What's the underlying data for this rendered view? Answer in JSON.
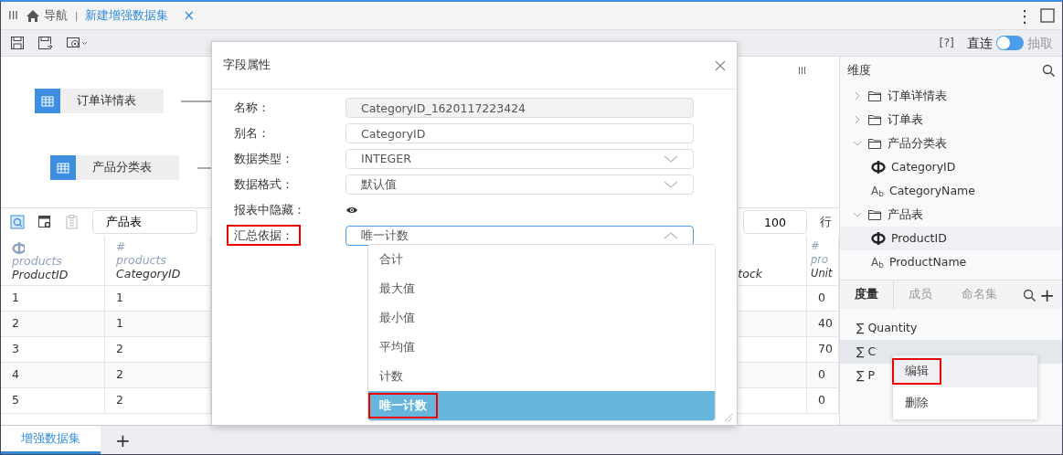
{
  "top_bar": {
    "menu_glyph": "III",
    "nav_label": "导航",
    "separator_glyph": "|",
    "tabs": [
      {
        "label": "新建增强数据集",
        "selected": true
      }
    ],
    "close_glyph": "×",
    "more_glyph": "⋮"
  },
  "toolbar": {
    "help": "[?]",
    "mode_options": [
      {
        "label": "直连",
        "selected": true
      },
      {
        "label": "抽取",
        "selected": false
      }
    ]
  },
  "diagram": {
    "handle_glyph": "III",
    "nodes": [
      {
        "label": "订单详情表"
      },
      {
        "label": "产品分类表"
      }
    ]
  },
  "table_toolbar": {
    "table_name": "产品表",
    "row_limit": "100",
    "row_unit": "行"
  },
  "table": {
    "columns": [
      {
        "kind": "key",
        "source": "products",
        "name": "ProductID"
      },
      {
        "kind": "number",
        "type_glyph": "#",
        "source": "products",
        "name": "CategoryID"
      },
      {
        "kind": "plain",
        "name": "tock"
      },
      {
        "kind": "number",
        "type_glyph": "#",
        "source": "pro",
        "name": "Unit"
      }
    ],
    "rows": [
      {
        "column_1": "1",
        "column_2": "1",
        "column_4": "0"
      },
      {
        "column_1": "2",
        "column_2": "1",
        "column_4": "40"
      },
      {
        "column_1": "3",
        "column_2": "2",
        "column_4": "70"
      },
      {
        "column_1": "4",
        "column_2": "2",
        "column_4": "0"
      },
      {
        "column_1": "5",
        "column_2": "2",
        "column_4": "0"
      }
    ]
  },
  "dimensions": {
    "title": "维度",
    "items": [
      {
        "label": "订单详情表",
        "expanded": false
      },
      {
        "label": "订单表",
        "expanded": false
      },
      {
        "label": "产品分类表",
        "expanded": true,
        "children": [
          {
            "kind": "key",
            "label": "CategoryID",
            "selected": false
          },
          {
            "kind": "text",
            "glyph": "A$_{b}$",
            "label": "CategoryName",
            "selected": false
          }
        ]
      },
      {
        "label": "产品表",
        "expanded": true,
        "children": [
          {
            "kind": "key",
            "label": "ProductID",
            "selected": true
          },
          {
            "kind": "text",
            "glyph": "A$_{b}$",
            "label": "ProductName",
            "selected": false
          }
        ]
      }
    ]
  },
  "measures": {
    "tabs": [
      {
        "label": "度量",
        "selected": true
      },
      {
        "label": "成员",
        "selected": false
      },
      {
        "label": "命名集",
        "selected": false
      }
    ],
    "add_glyph": "+",
    "items": [
      {
        "glyph": "∑",
        "label": "Quantity",
        "hovered": false
      },
      {
        "glyph": "∑",
        "label": "C",
        "hovered": true
      },
      {
        "glyph": "∑",
        "label": "P",
        "hovered": false
      }
    ]
  },
  "field_dialog": {
    "title": "字段属性",
    "fields": [
      {
        "kind": "readonly",
        "label": "名称：",
        "value": "CategoryID_1620117223424",
        "annotated": false
      },
      {
        "kind": "text",
        "label": "别名：",
        "value": "CategoryID",
        "annotated": false
      },
      {
        "kind": "select",
        "label": "数据类型：",
        "value": "INTEGER",
        "open": false,
        "annotated": false
      },
      {
        "kind": "select",
        "label": "数据格式：",
        "value": "默认值",
        "open": false,
        "annotated": false
      },
      {
        "kind": "visibility",
        "label": "报表中隐藏：",
        "annotated": false
      },
      {
        "kind": "select",
        "label": "汇总依据：",
        "value": "唯一计数",
        "open": true,
        "annotated": true
      }
    ],
    "options": [
      {
        "label": "合计",
        "selected": false,
        "annotated": false
      },
      {
        "label": "最大值",
        "selected": false,
        "annotated": false
      },
      {
        "label": "最小值",
        "selected": false,
        "annotated": false
      },
      {
        "label": "平均值",
        "selected": false,
        "annotated": false
      },
      {
        "label": "计数",
        "selected": false,
        "annotated": false
      },
      {
        "label": "唯一计数",
        "selected": true,
        "annotated": true
      }
    ]
  },
  "context_menu": {
    "items": [
      {
        "label": "编辑",
        "hovered": true,
        "annotated": true
      },
      {
        "label": "删除",
        "hovered": false,
        "annotated": false
      }
    ]
  },
  "bottom_tabs": {
    "tabs": [
      {
        "label": "增强数据集",
        "selected": true
      }
    ],
    "add_glyph": "+"
  }
}
